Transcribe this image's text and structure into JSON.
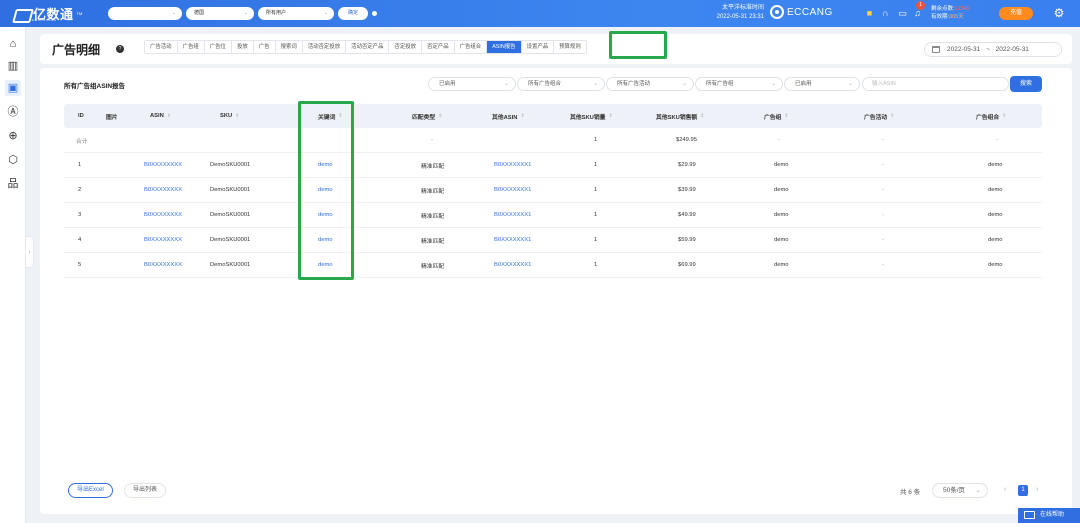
{
  "topbar": {
    "logo_text": "亿数通",
    "logo_sub": "EMSOSTONG",
    "logo_tm": "TM",
    "store_select": "",
    "market_select": "德国",
    "user_select": "所有用户",
    "confirm_btn": "确定",
    "timezone_label": "太平洋标准时间",
    "timezone_time": "2022-05-31 23:31",
    "brand": "ECCANG",
    "badge_count": "1",
    "points_label": "剩余点数:",
    "points_value": "12345",
    "expire_label": "有效期:",
    "expire_value": "365天",
    "recharge_btn": "充值"
  },
  "sidebar": {
    "icons": [
      "home-icon",
      "bar-chart-icon",
      "ad-icon",
      "ai-icon",
      "target-icon",
      "cube-icon",
      "org-chart-icon"
    ]
  },
  "header": {
    "title": "广告明细",
    "tabs": [
      "广告活动",
      "广告组",
      "广告位",
      "投放",
      "广告",
      "搜索词",
      "活动否定投放",
      "活动否定产品",
      "否定投放",
      "否定产品",
      "广告组合",
      "ASIN报告",
      "设置产品",
      "预算规则"
    ],
    "active_tab": "ASIN报告",
    "date_start": "2022-05-31",
    "date_sep": "~",
    "date_end": "2022-05-31"
  },
  "report": {
    "title": "所有广告组ASIN报告",
    "filters": [
      "已启用",
      "所有广告组合",
      "所有广告活动",
      "所有广告组",
      "已启用"
    ],
    "search_placeholder": "输入ASIN",
    "search_btn": "搜索"
  },
  "table": {
    "headers": [
      "ID",
      "图片",
      "ASIN",
      "SKU",
      "关键词",
      "匹配类型",
      "其他ASIN",
      "其他SKU销量",
      "其他SKU销售额",
      "广告组",
      "广告活动",
      "广告组合"
    ],
    "total_row": {
      "id": "合计",
      "match": "-",
      "other_sku_qty": "1",
      "other_sku_sales": "$249.95",
      "group": "-",
      "campaign": "-",
      "portfolio": "-"
    },
    "rows": [
      {
        "id": "1",
        "asin": "B0XXXXXXXX",
        "sku": "DemoSKU0001",
        "keyword": "demo",
        "match": "精准匹配",
        "other_asin": "B0XXXXXXX1",
        "other_sku_qty": "1",
        "other_sku_sales": "$29.99",
        "group": "demo",
        "campaign": "-",
        "portfolio": "demo"
      },
      {
        "id": "2",
        "asin": "B0XXXXXXXX",
        "sku": "DemoSKU0001",
        "keyword": "demo",
        "match": "精准匹配",
        "other_asin": "B0XXXXXXX1",
        "other_sku_qty": "1",
        "other_sku_sales": "$39.99",
        "group": "demo",
        "campaign": "-",
        "portfolio": "demo"
      },
      {
        "id": "3",
        "asin": "B0XXXXXXXX",
        "sku": "DemoSKU0001",
        "keyword": "demo",
        "match": "精准匹配",
        "other_asin": "B0XXXXXXX1",
        "other_sku_qty": "1",
        "other_sku_sales": "$49.99",
        "group": "demo",
        "campaign": "-",
        "portfolio": "demo"
      },
      {
        "id": "4",
        "asin": "B0XXXXXXXX",
        "sku": "DemoSKU0001",
        "keyword": "demo",
        "match": "精准匹配",
        "other_asin": "B0XXXXXXX1",
        "other_sku_qty": "1",
        "other_sku_sales": "$59.99",
        "group": "demo",
        "campaign": "-",
        "portfolio": "demo"
      },
      {
        "id": "5",
        "asin": "B0XXXXXXXX",
        "sku": "DemoSKU0001",
        "keyword": "demo",
        "match": "精准匹配",
        "other_asin": "B0XXXXXXX1",
        "other_sku_qty": "1",
        "other_sku_sales": "$69.99",
        "group": "demo",
        "campaign": "-",
        "portfolio": "demo"
      }
    ]
  },
  "footer": {
    "export_excel": "导出Excel",
    "export_columns": "导出列表",
    "total": "共 6 条",
    "page_size": "50条/页",
    "current_page": "1",
    "prev": "‹",
    "next": "›"
  },
  "online_help": "在线帮助",
  "colors": {
    "primary": "#2f6fe0",
    "highlight": "#27a84a",
    "recharge": "#ff8a1e"
  }
}
